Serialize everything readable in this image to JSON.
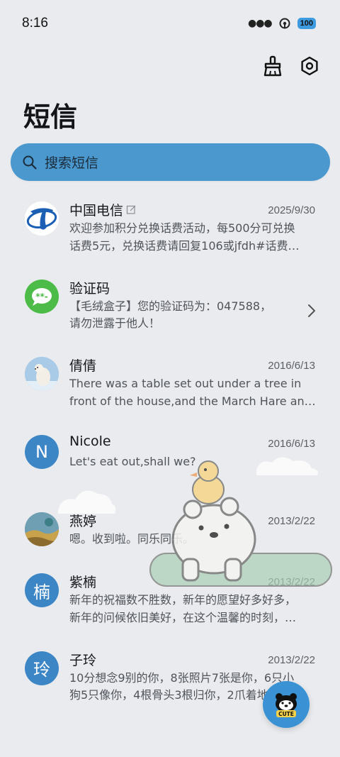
{
  "status": {
    "time": "8:16",
    "battery": "100"
  },
  "title": "短信",
  "search": {
    "placeholder": "搜索短信"
  },
  "conversations": [
    {
      "name": "中国电信",
      "date": "2025/9/30",
      "line1": "欢迎参加积分兑换话费活动，每500分可兑换",
      "line2": "话费5元，兑换话费请回复106或jfdh#话费…",
      "avatar": "telecom-logo"
    },
    {
      "name": "验证码",
      "date": "",
      "line1": "【毛绒盒子】您的验证码为：047588，",
      "line2": "请勿泄露于他人！",
      "avatar": "message-bubble"
    },
    {
      "name": "倩倩",
      "date": "2016/6/13",
      "line1": "There was a table set out under a tree in",
      "line2": "front of the house,and the March Hare an…",
      "avatar": "polar-bear-photo"
    },
    {
      "name": "Nicole",
      "date": "2016/6/13",
      "line1": "Let's eat out,shall we?",
      "line2": "",
      "avatar_letter": "N"
    },
    {
      "name": "燕婷",
      "date": "2013/2/22",
      "line1": "嗯。收到啦。同乐同乐。",
      "line2": "",
      "avatar": "landscape-photo"
    },
    {
      "name": "紫楠",
      "date": "2013/2/22",
      "line1": "新年的祝福数不胜数，新年的愿望好多好多，",
      "line2": "新年的问候依旧美好，在这个温馨的时刻，…",
      "avatar_letter": "楠"
    },
    {
      "name": "子玲",
      "date": "2013/2/22",
      "line1": "10分想念9别的你，8张照片7张是你，6只小",
      "line2": "狗5只像你，4根骨头3根归你，2爪着地1定…",
      "avatar_letter": "玲"
    }
  ],
  "fab": {
    "label": "CUTE"
  },
  "colors": {
    "accent": "#4a98cd",
    "avatar_blue": "#3d86c6",
    "background": "#e9ebee"
  }
}
